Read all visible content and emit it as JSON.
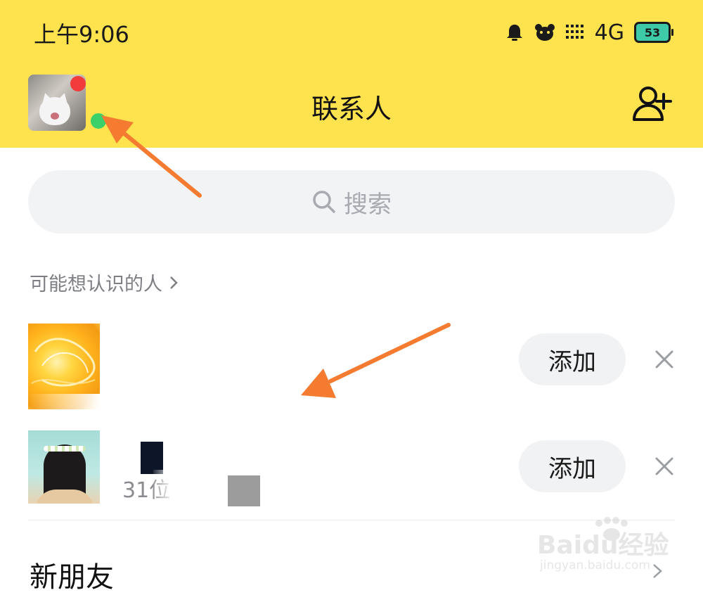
{
  "status_bar": {
    "time": "上午9:06",
    "network": "4G",
    "battery": "53"
  },
  "header": {
    "title": "联系人"
  },
  "search": {
    "placeholder": "搜索"
  },
  "suggestions": {
    "title": "可能想认识的人",
    "items": [
      {
        "add_label": "添加",
        "subtitle": ""
      },
      {
        "add_label": "添加",
        "subtitle": "31位"
      }
    ]
  },
  "new_friends": {
    "label": "新朋友"
  },
  "watermark": {
    "brand": "Baidu经验",
    "url": "jingyan.baidu.com"
  },
  "colors": {
    "header_bg": "#fee24e",
    "accent_arrow": "#f47b30",
    "online": "#3bd06a",
    "badge": "#f23b3b"
  }
}
